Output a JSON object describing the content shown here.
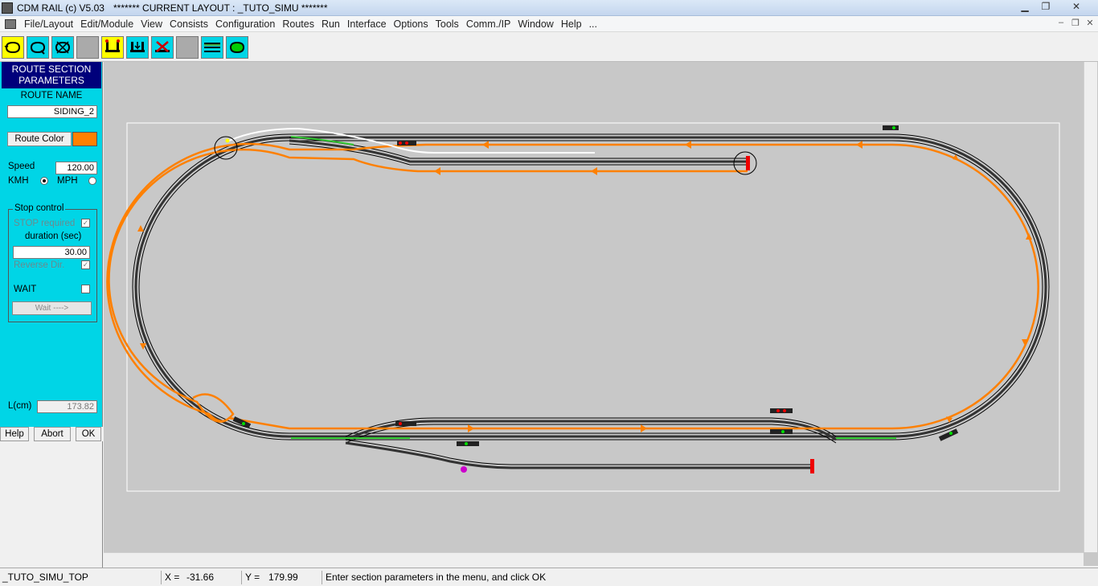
{
  "window": {
    "title": "CDM RAIL (c) V5.03",
    "layout_title": "******* CURRENT LAYOUT : _TUTO_SIMU *******"
  },
  "menu": {
    "items": [
      "File/Layout",
      "Edit/Module",
      "View",
      "Consists",
      "Configuration",
      "Routes",
      "Run",
      "Interface",
      "Options",
      "Tools",
      "Comm./IP",
      "Window",
      "Help",
      "..."
    ]
  },
  "toolbar": {
    "buttons": [
      "route-loop-icon",
      "route-loop-add-icon",
      "route-loop-delete-icon",
      "blank-icon",
      "train-yellow-icon",
      "train-split-icon",
      "train-cross-icon",
      "blank-icon",
      "tracks-icon",
      "loop-green-icon"
    ]
  },
  "panel": {
    "header_line1": "ROUTE SECTION",
    "header_line2": "PARAMETERS",
    "route_name_label": "ROUTE NAME",
    "route_name_value": "SIDING_2",
    "route_color_label": "Route Color",
    "route_color_value": "#ff8000",
    "speed_label": "Speed",
    "speed_value": "120.00",
    "unit_kmh": "KMH",
    "unit_mph": "MPH",
    "stop_control_label": "Stop control",
    "stop_required_label": "STOP required",
    "duration_label": "duration (sec)",
    "duration_value": "30.00",
    "reverse_dir_label": "Reverse Dir.",
    "wait_label": "WAIT",
    "wait_button_label": "Wait ---->",
    "length_label": "L(cm)",
    "length_value": "173.82",
    "help_button": "Help",
    "abort_button": "Abort",
    "ok_button": "OK"
  },
  "status": {
    "module": "_TUTO_SIMU_TOP",
    "x_label": "X =",
    "x_value": "-31.66",
    "y_label": "Y =",
    "y_value": "179.99",
    "message": "Enter section parameters in the menu, and click OK"
  },
  "colors": {
    "route": "#ff8000",
    "panel_bg": "#00d5e6",
    "panel_header": "#00007b",
    "canvas_bg": "#c8c8c8"
  }
}
